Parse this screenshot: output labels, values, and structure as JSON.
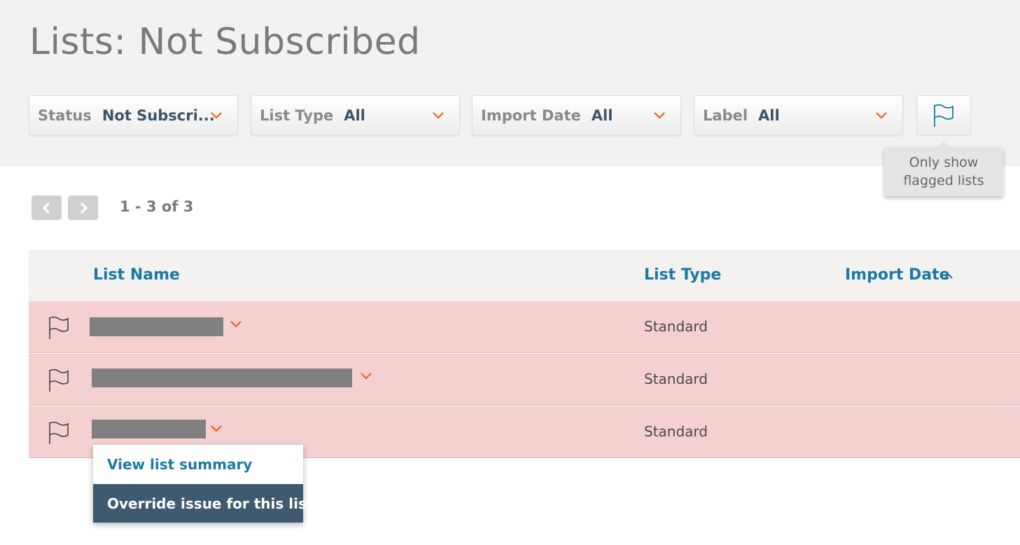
{
  "page": {
    "title": "Lists: Not Subscribed"
  },
  "filters": [
    {
      "label": "Status",
      "value": "Not Subscri..."
    },
    {
      "label": "List Type",
      "value": "All"
    },
    {
      "label": "Import Date",
      "value": "All"
    },
    {
      "label": "Label",
      "value": "All"
    }
  ],
  "flag_toggle": {
    "icon": "flag-icon",
    "tooltip_line1": "Only show",
    "tooltip_line2": "flagged lists"
  },
  "pagination": {
    "prev_icon": "chevron-left-icon",
    "next_icon": "chevron-right-icon",
    "count": "1 - 3 of 3"
  },
  "table": {
    "headers": {
      "list_name": "List Name",
      "list_type": "List Type",
      "import_date": "Import Date"
    },
    "sort_icon": "chevron-up-icon",
    "rows": [
      {
        "list_type": "Standard",
        "name_redacted": true
      },
      {
        "list_type": "Standard",
        "name_redacted": true
      },
      {
        "list_type": "Standard",
        "name_redacted": true
      }
    ]
  },
  "row_menu": {
    "items": [
      "View list summary",
      "Override issue for this list"
    ]
  },
  "colors": {
    "accent": "#1a7aa4",
    "chevron": "#e8641c",
    "row_error_bg": "#f4d1d0",
    "menu_active_bg": "#3e5a6e"
  }
}
